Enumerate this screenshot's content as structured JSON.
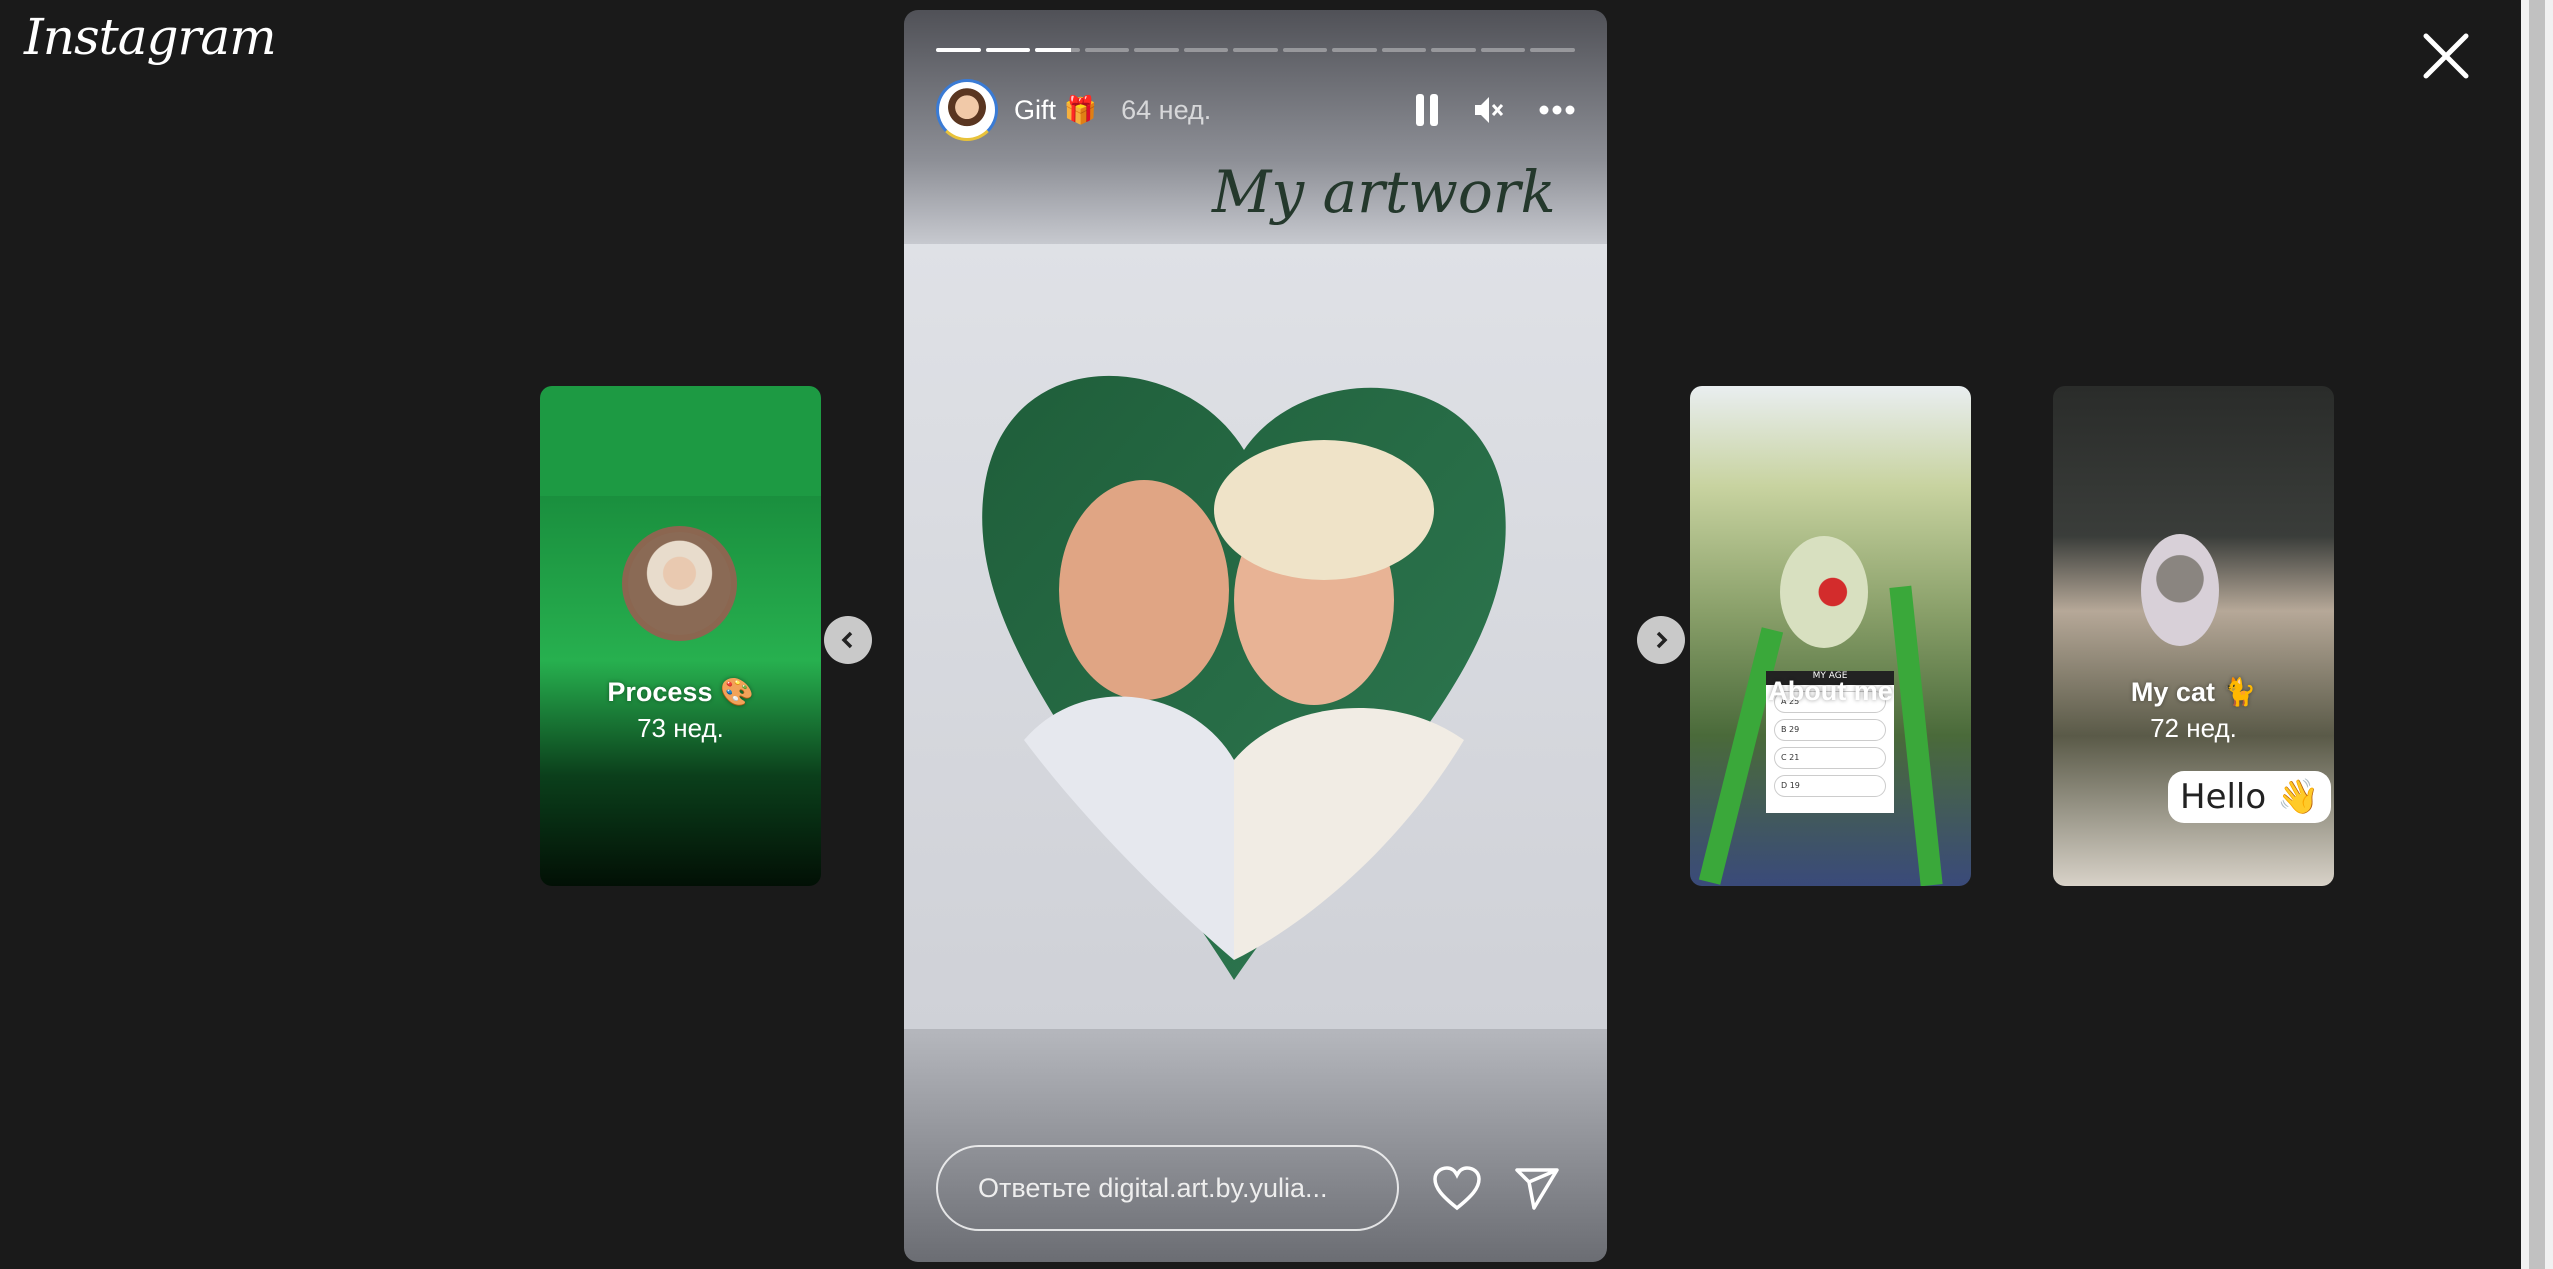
{
  "app": {
    "logo": "Instagram"
  },
  "story": {
    "segments_total": 13,
    "segments_done": 2,
    "current_segment_progress": 0.8,
    "username": "Gift 🎁",
    "time": "64 нед.",
    "overlay_text": "My artwork",
    "reply_placeholder": "Ответьте digital.art.by.yulia...",
    "icons": {
      "pause": "pause-icon",
      "mute": "muted-speaker-icon",
      "more": "more-horizontal-icon",
      "like": "heart-icon",
      "share": "send-icon"
    }
  },
  "cards": [
    {
      "title": "Process 🎨",
      "time": "73 нед."
    },
    {
      "title": "About me",
      "quiz_title": "MY AGE",
      "quiz_options": [
        "A 25",
        "B 29",
        "C 21",
        "D 19"
      ]
    },
    {
      "title": "My cat 🐈",
      "time": "72 нед.",
      "sticker": "Hello 👋"
    }
  ],
  "colors": {
    "background": "#1a1a1a",
    "process_card": "#1f9e45"
  }
}
